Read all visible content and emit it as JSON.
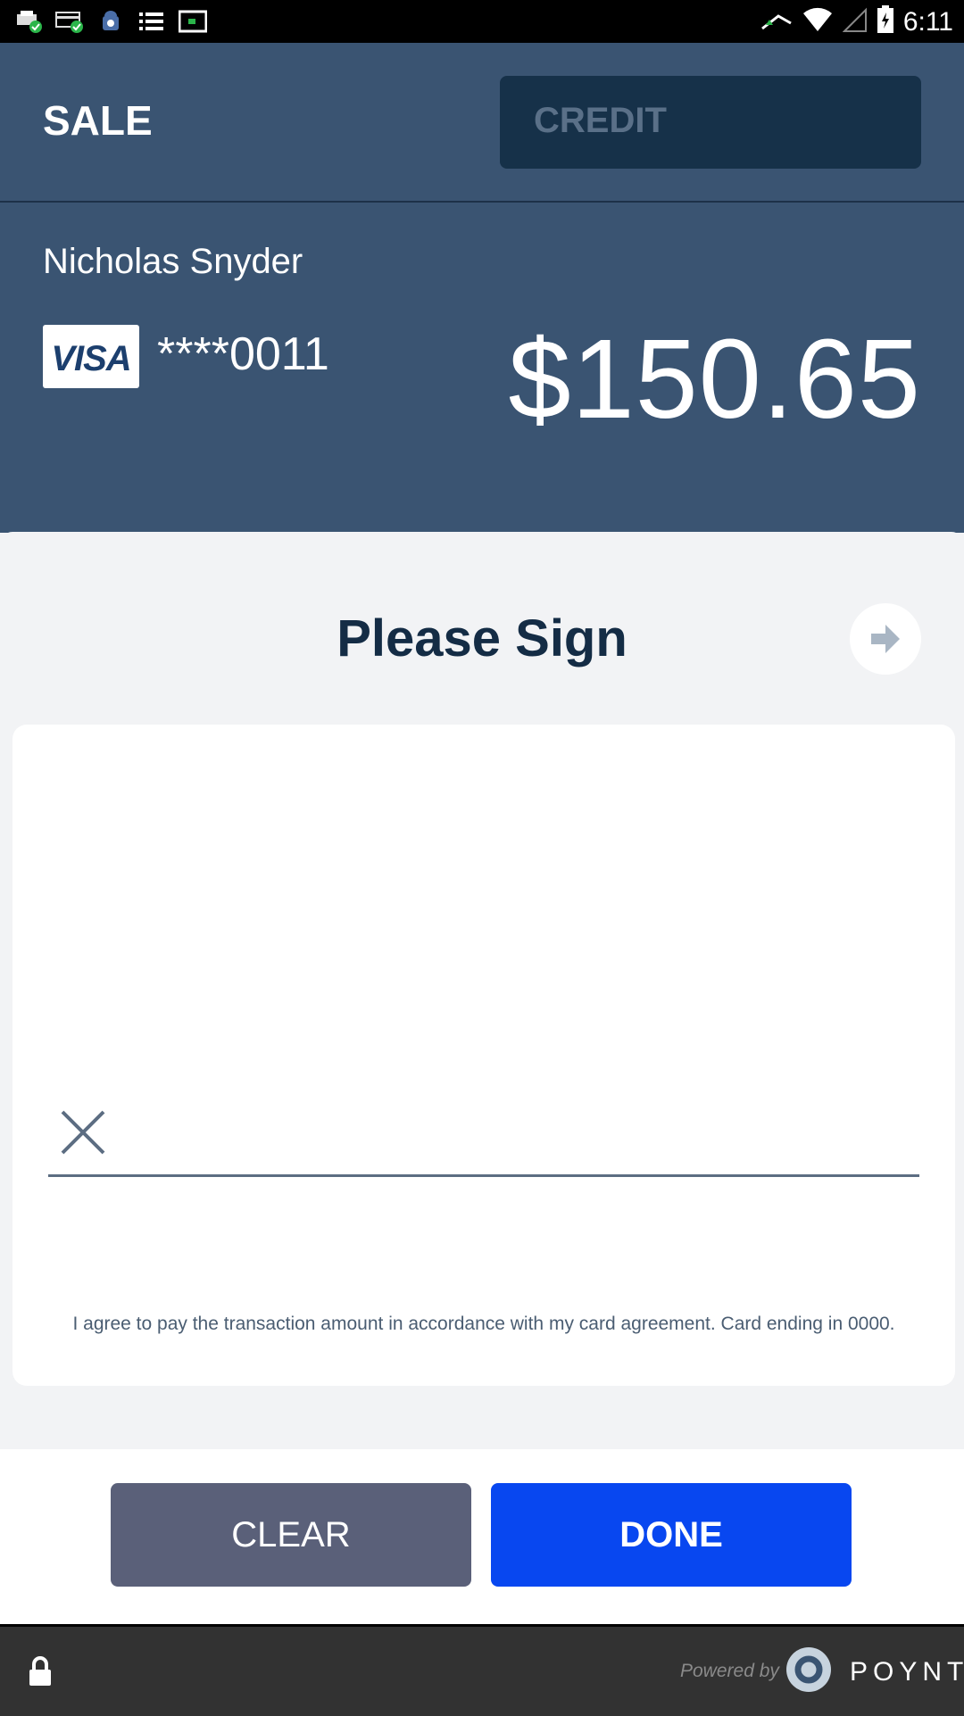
{
  "status_bar": {
    "time": "6:11",
    "icons_left": [
      "printer-check-icon",
      "card-check-icon",
      "android-icon",
      "list-icon",
      "screen-icon"
    ],
    "icons_right": [
      "cloud-up-icon",
      "wifi-icon",
      "signal-icon",
      "battery-icon"
    ]
  },
  "header": {
    "title": "SALE",
    "payment_type": "CREDIT"
  },
  "card": {
    "holder_name": "Nicholas Snyder",
    "brand": "VISA",
    "masked_number": "****0011",
    "amount": "$150.65"
  },
  "sign": {
    "title": "Please Sign",
    "agreement": "I agree to pay the transaction amount in accordance with my card agreement. Card ending in 0000."
  },
  "buttons": {
    "clear_label": "CLEAR",
    "done_label": "DONE"
  },
  "footer": {
    "powered_by": "Powered by",
    "brand": "POYNT"
  },
  "colors": {
    "header_bg": "#3a5472",
    "credit_box": "#163149",
    "done_button": "#0847f0",
    "clear_button": "#5a6079",
    "footer_bg": "#323232"
  }
}
